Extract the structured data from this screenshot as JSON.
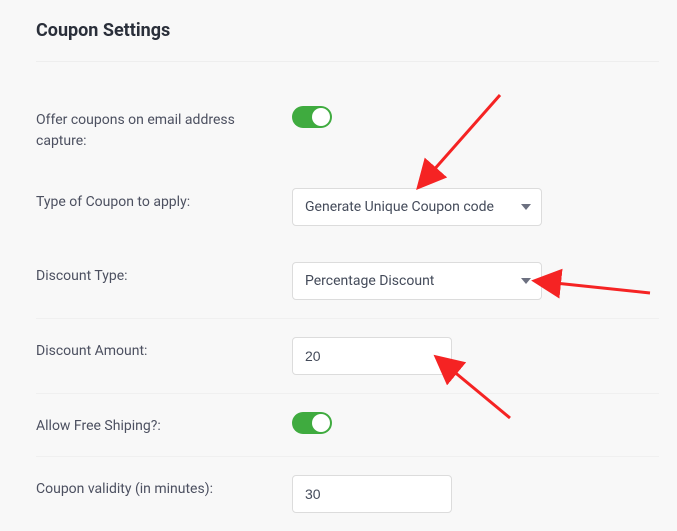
{
  "section_title": "Coupon Settings",
  "rows": {
    "offer_coupons": {
      "label": "Offer coupons on email address capture:",
      "value": true
    },
    "coupon_type": {
      "label": "Type of Coupon to apply:",
      "selected": "Generate Unique Coupon code"
    },
    "discount_type": {
      "label": "Discount Type:",
      "selected": "Percentage Discount"
    },
    "discount_amount": {
      "label": "Discount Amount:",
      "value": "20"
    },
    "free_shipping": {
      "label": "Allow Free Shiping?:",
      "value": true
    },
    "validity": {
      "label": "Coupon validity (in minutes):",
      "value": "30"
    }
  },
  "accent_color": "#3fab3f"
}
